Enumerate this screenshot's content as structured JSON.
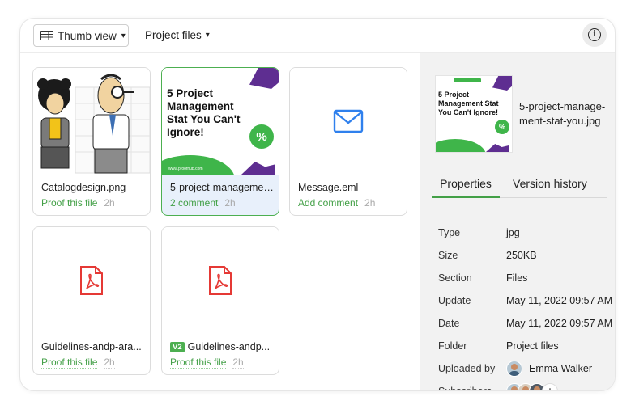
{
  "toolbar": {
    "view_label": "Thumb view",
    "folder_label": "Project files"
  },
  "files": [
    {
      "name": "Catalogdesign.png",
      "action": "Proof this file",
      "age": "2h"
    },
    {
      "name": "5-project-management-stat-you.jpg",
      "action": "2  comment",
      "age": "2h",
      "selected": true,
      "thumb_title": "5 Project Management Stat You Can't Ignore!",
      "thumb_badge": "%",
      "thumb_url": "www.proofhub.com"
    },
    {
      "name": "Message.eml",
      "action": "Add comment",
      "age": "2h"
    },
    {
      "name": "Guidelines-andp-ara...",
      "action": "Proof this file",
      "age": "2h"
    },
    {
      "name": "Guidelines-andp...",
      "version": "V2",
      "action": "Proof this file",
      "age": "2h"
    }
  ],
  "details": {
    "preview_name": "5-project-manage-ment-stat-you.jpg",
    "preview_title": "5 Project Management Stat You Can't Ignore!",
    "preview_badge": "%",
    "tabs": [
      "Properties",
      "Version history"
    ],
    "properties": [
      {
        "key": "Type",
        "value": "jpg"
      },
      {
        "key": "Size",
        "value": "250KB"
      },
      {
        "key": "Section",
        "value": "Files"
      },
      {
        "key": "Update",
        "value": "May 11, 2022 09:57 AM"
      },
      {
        "key": "Date",
        "value": "May 11, 2022 09:57 AM"
      },
      {
        "key": "Folder",
        "value": "Project files"
      },
      {
        "key": "Uploaded by",
        "value": "Emma Walker"
      },
      {
        "key": "Subscribers",
        "value": ""
      }
    ],
    "add_subscriber": "+"
  },
  "colors": {
    "accent_green": "#43a047",
    "brand_purple": "#5e2e91",
    "pdf_red": "#e53935",
    "mail_blue": "#2f80ed"
  }
}
